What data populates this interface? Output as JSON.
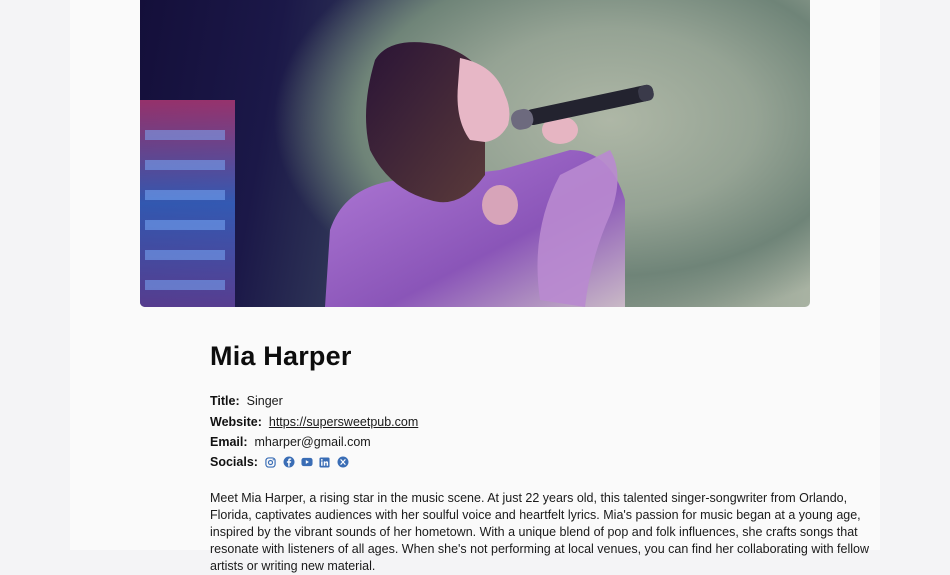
{
  "profile": {
    "name": "Mia Harper",
    "title_label": "Title:",
    "title_value": "Singer",
    "website_label": "Website:",
    "website_value": "https://supersweetpub.com",
    "email_label": "Email:",
    "email_value": "mharper@gmail.com",
    "socials_label": "Socials:",
    "socials": [
      "instagram-icon",
      "facebook-icon",
      "youtube-icon",
      "linkedin-icon",
      "x-icon"
    ],
    "bio": "Meet Mia Harper, a rising star in the music scene. At just 22 years old, this talented singer-songwriter from Orlando, Florida, captivates audiences with her soulful voice and heartfelt lyrics. Mia's passion for music began at a young age, inspired by the vibrant sounds of her hometown. With a unique blend of pop and folk influences, she crafts songs that resonate with listeners of all ages. When she's not performing at local venues, you can find her collaborating with fellow artists or writing new material."
  },
  "colors": {
    "link": "#3a6db5",
    "icon": "#3a6db5",
    "page_bg": "#fafafa",
    "outer_bg": "#f4f4f6"
  }
}
